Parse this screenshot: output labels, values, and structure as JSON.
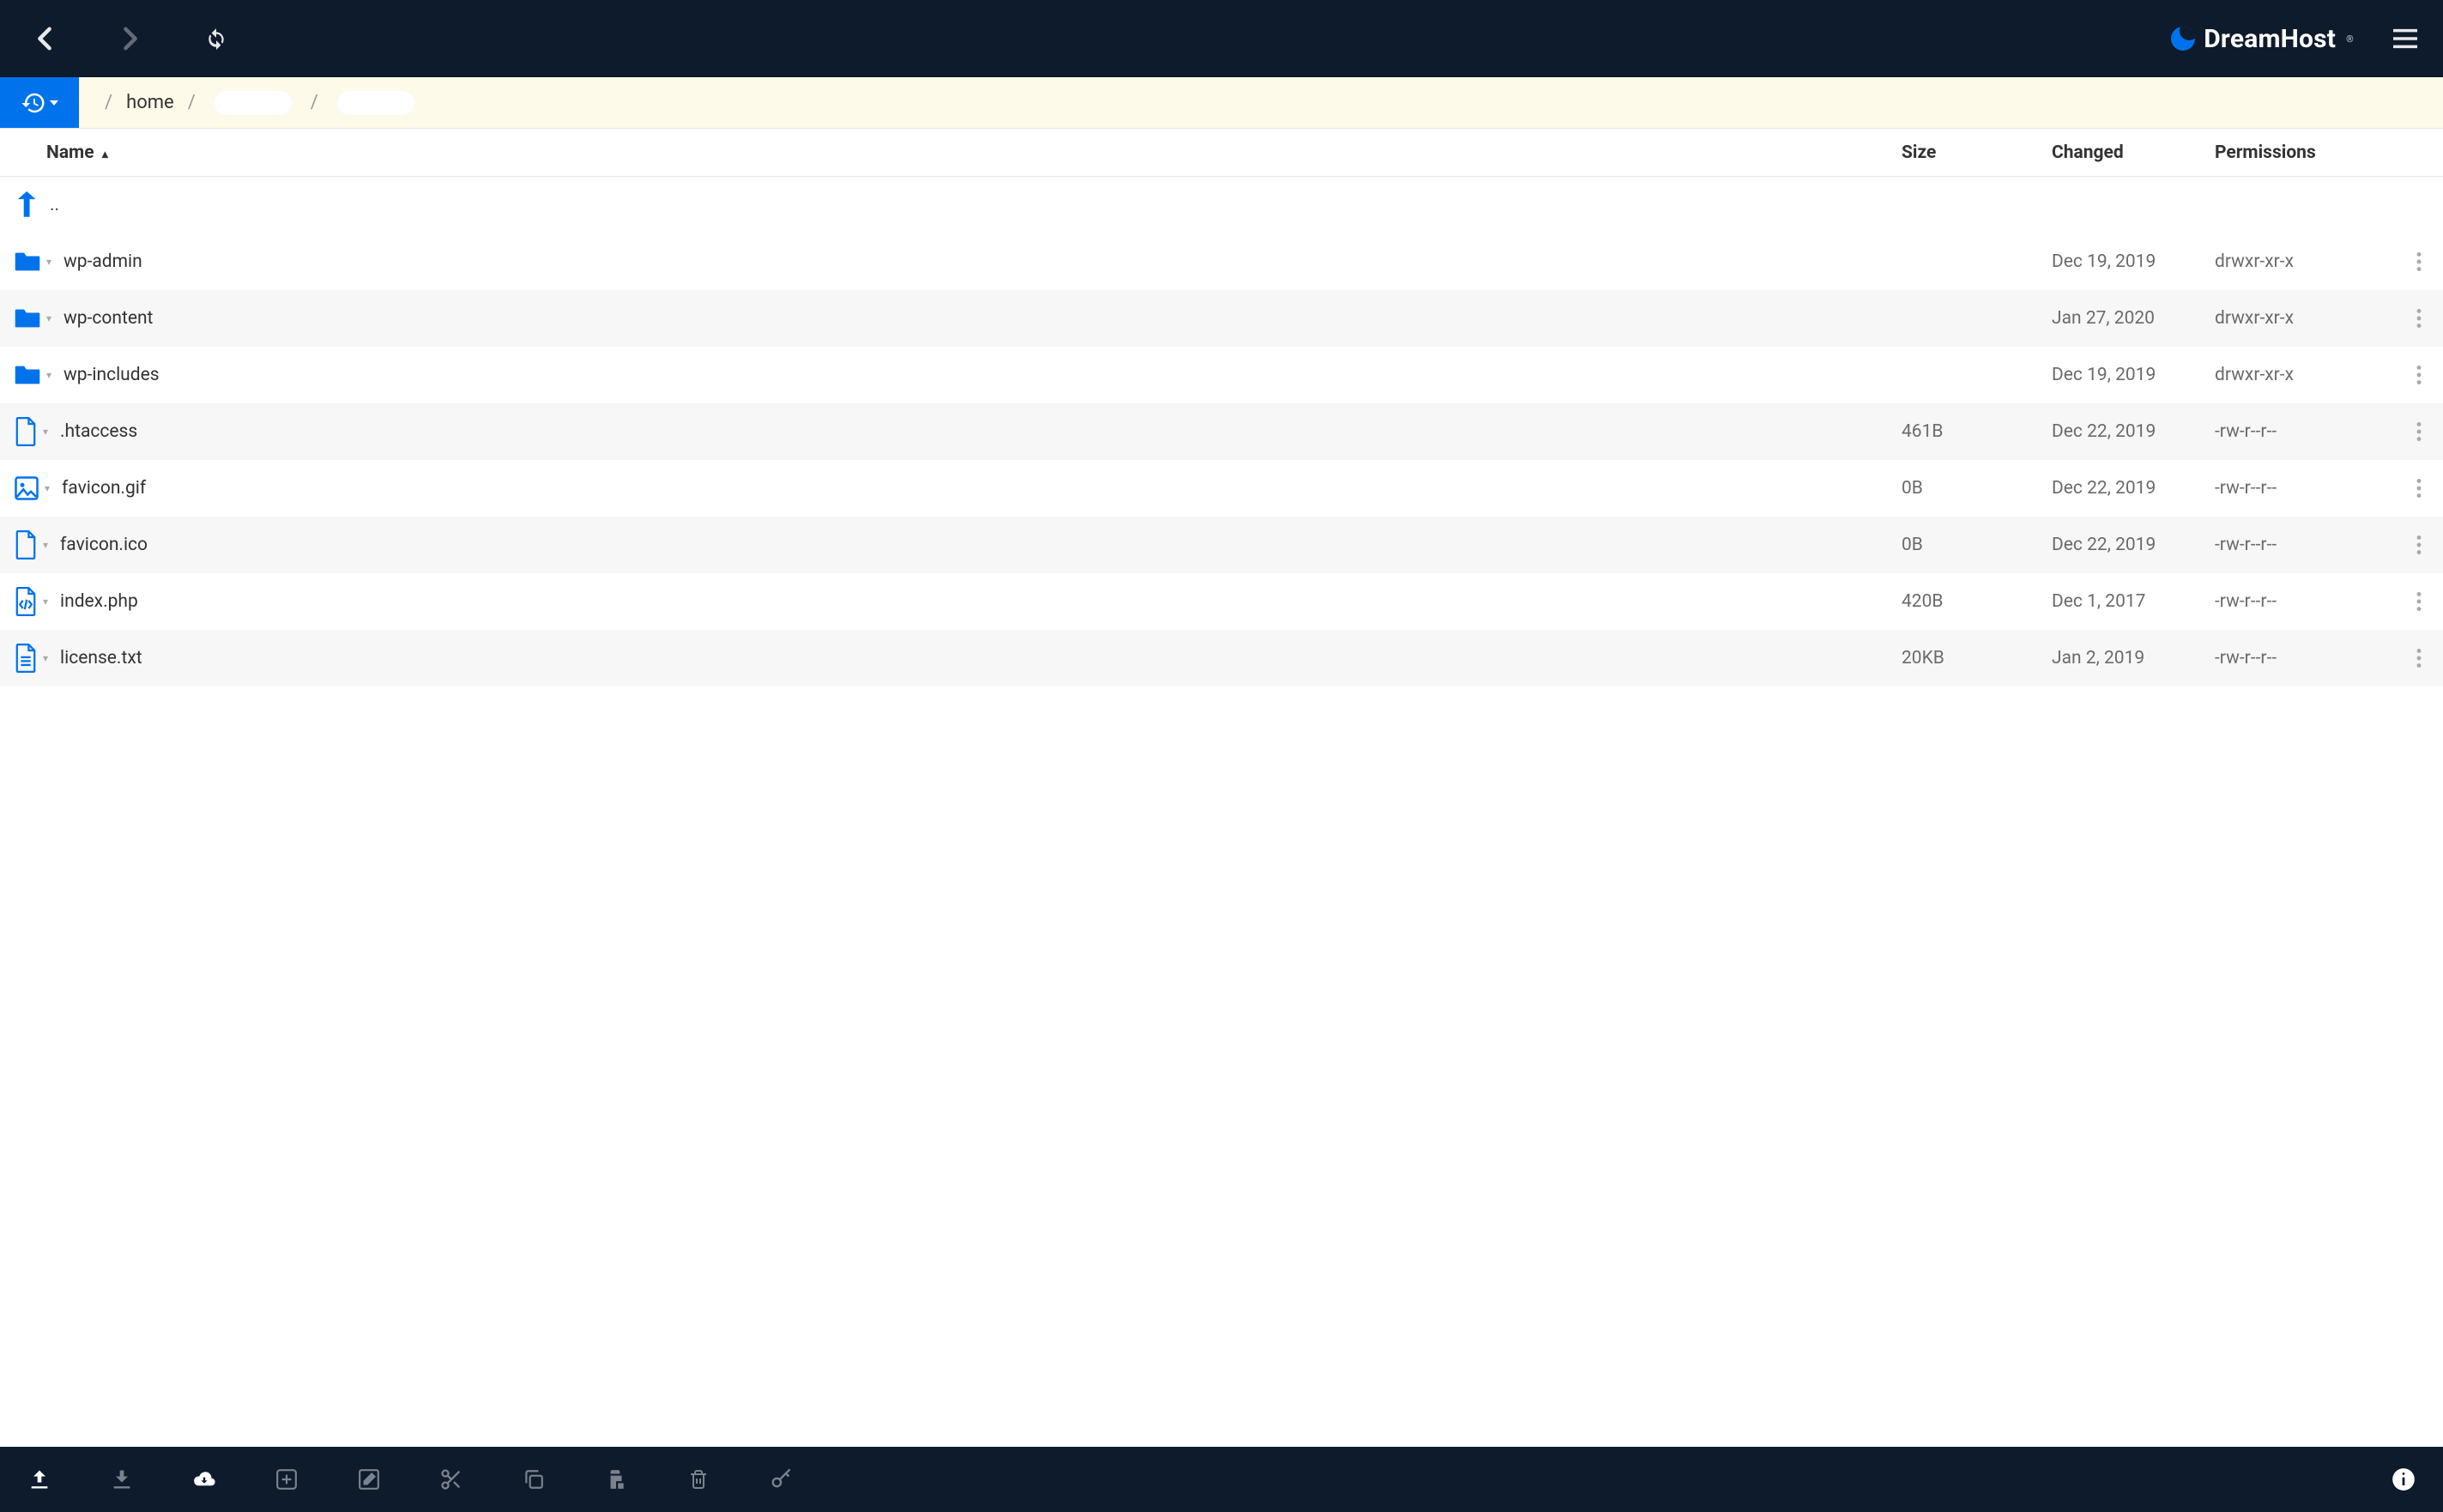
{
  "brand": {
    "name": "DreamHost"
  },
  "breadcrumbs": {
    "segments": [
      {
        "label": "home",
        "blank": false
      },
      {
        "label": "",
        "blank": true
      },
      {
        "label": "",
        "blank": true
      }
    ]
  },
  "columns": {
    "name": "Name",
    "size": "Size",
    "changed": "Changed",
    "permissions": "Permissions",
    "sort_indicator": "▴"
  },
  "up_row": {
    "label": ".."
  },
  "files": [
    {
      "type": "folder",
      "name": "wp-admin",
      "size": "",
      "changed": "Dec 19, 2019",
      "perm": "drwxr-xr-x"
    },
    {
      "type": "folder",
      "name": "wp-content",
      "size": "",
      "changed": "Jan 27, 2020",
      "perm": "drwxr-xr-x"
    },
    {
      "type": "folder",
      "name": "wp-includes",
      "size": "",
      "changed": "Dec 19, 2019",
      "perm": "drwxr-xr-x"
    },
    {
      "type": "file",
      "name": ".htaccess",
      "size": "461B",
      "changed": "Dec 22, 2019",
      "perm": "-rw-r--r--"
    },
    {
      "type": "image",
      "name": "favicon.gif",
      "size": "0B",
      "changed": "Dec 22, 2019",
      "perm": "-rw-r--r--"
    },
    {
      "type": "file",
      "name": "favicon.ico",
      "size": "0B",
      "changed": "Dec 22, 2019",
      "perm": "-rw-r--r--"
    },
    {
      "type": "code",
      "name": "index.php",
      "size": "420B",
      "changed": "Dec 1, 2017",
      "perm": "-rw-r--r--"
    },
    {
      "type": "text",
      "name": "license.txt",
      "size": "20KB",
      "changed": "Jan 2, 2019",
      "perm": "-rw-r--r--"
    }
  ]
}
